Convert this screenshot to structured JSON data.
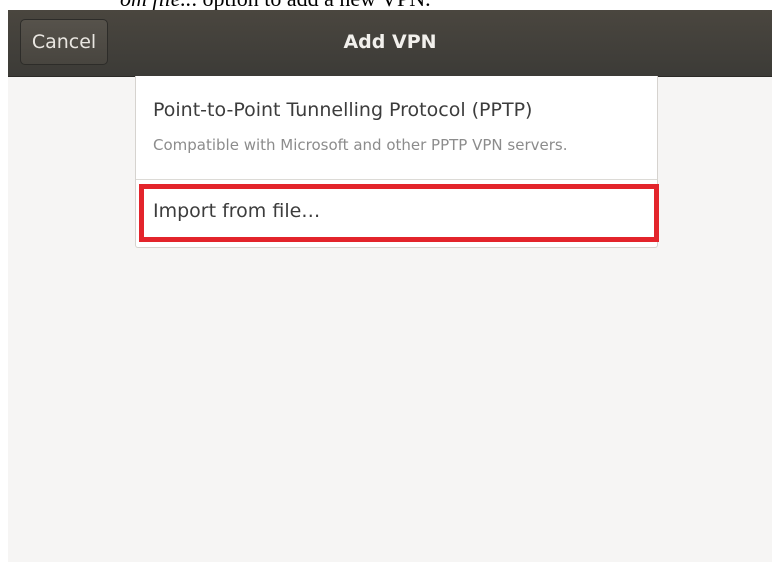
{
  "caption": {
    "italic_part": "om file..",
    "rest": ". option to add a new VPN."
  },
  "header": {
    "cancel_label": "Cancel",
    "title": "Add VPN"
  },
  "vpn_types": [
    {
      "name": "Point-to-Point Tunnelling Protocol (PPTP)",
      "description": "Compatible with Microsoft and other PPTP VPN servers."
    }
  ],
  "import_option": {
    "label": "Import from file…"
  },
  "highlight_color": "#e3242b"
}
